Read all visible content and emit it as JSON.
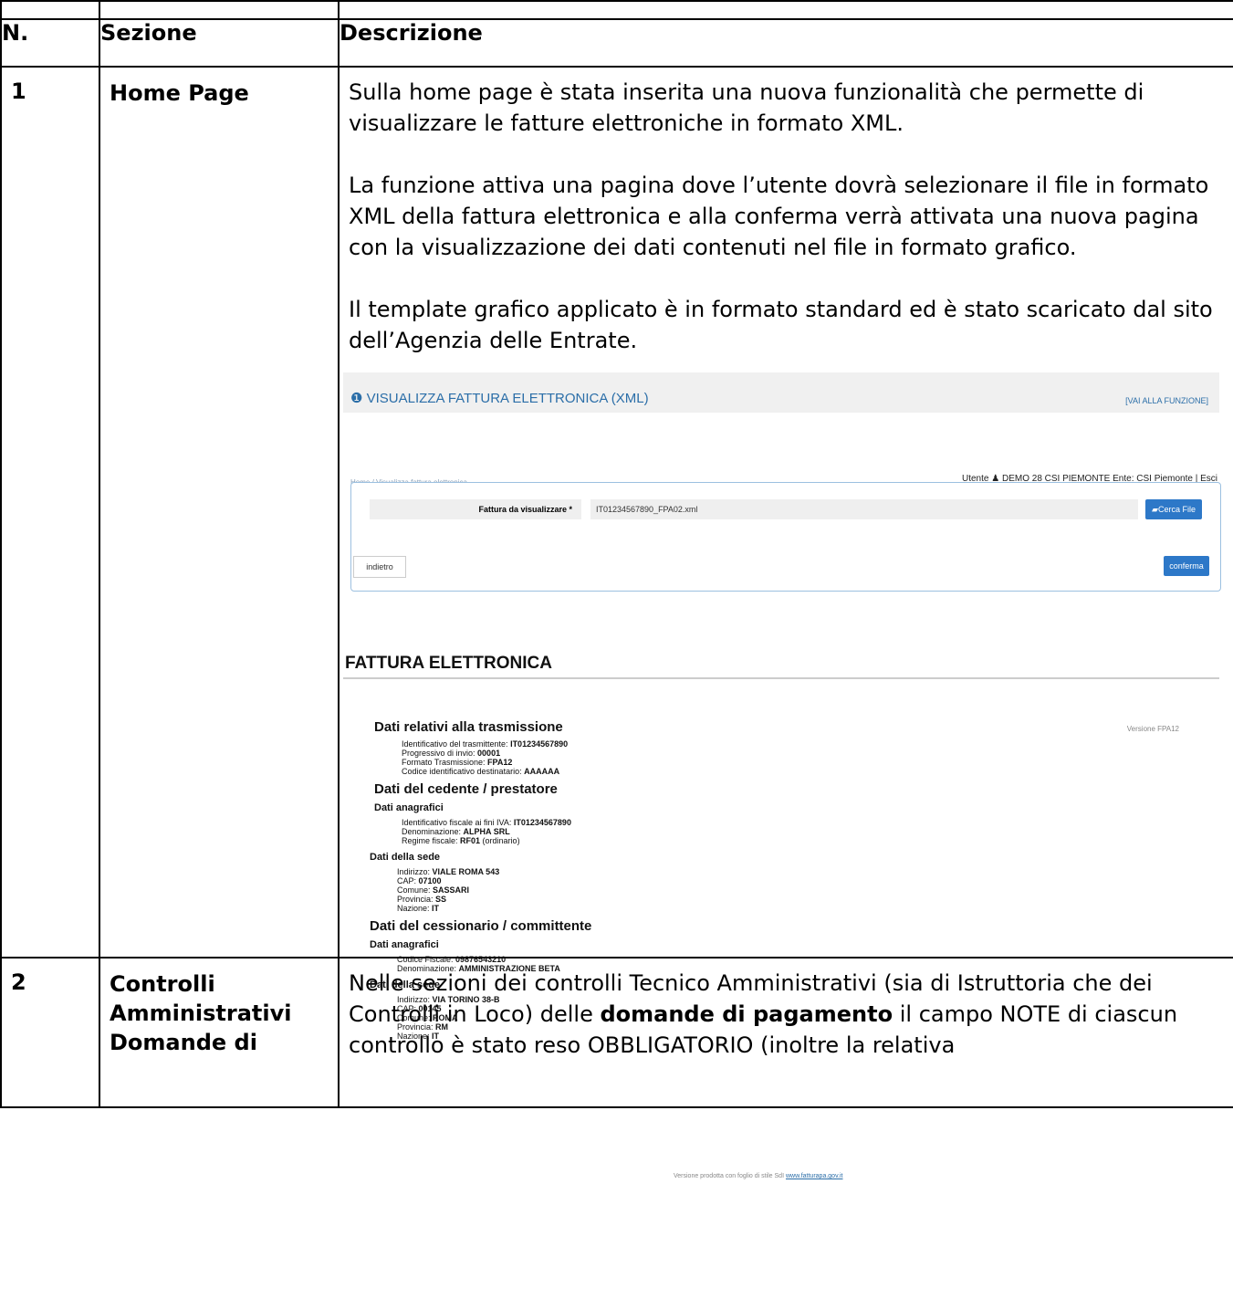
{
  "header": {
    "num": "N.",
    "sezione": "Sezione",
    "descrizione": "Descrizione"
  },
  "row1": {
    "num": "1",
    "sezione": "Home Page",
    "paragraphs": [
      "Sulla home page è stata inserita una nuova funzionalità che permette di visualizzare le fatture elettroniche in formato XML.",
      "La funzione attiva una pagina dove l’utente dovrà selezionare il file in formato XML della fattura elettronica e alla conferma verrà attivata una nuova pagina con la visualizzazione dei dati contenuti nel file in formato grafico.",
      "Il template grafico applicato è in formato standard ed è stato scaricato dal sito dell’Agenzia delle Entrate."
    ],
    "screenshot": {
      "title": "VISUALIZZA FATTURA ELETTRONICA (XML)",
      "link": "[VAI ALLA FUNZIONE]",
      "breadcrumb": "Home / Visualizza fattura elettronica",
      "user": "Utente ♟ DEMO 28 CSI PIEMONTE   Ente: CSI Piemonte | Esci",
      "field_label": "Fattura da visualizzare *",
      "field_value": "IT01234567890_FPA02.xml",
      "search_button": "Cerca File",
      "back_button": "indietro",
      "confirm_button": "conferma",
      "invoice_title": "FATTURA ELETTRONICA",
      "version": "Versione FPA12",
      "footer_text": "Versione prodotta con foglio di stile SdI",
      "footer_link": "www.fatturapa.gov.it",
      "trasmissione": {
        "title": "Dati relativi alla trasmissione",
        "l1": "Identificativo del trasmittente: ",
        "v1": "IT01234567890",
        "l2": "Progressivo di invio: ",
        "v2": "00001",
        "l3": "Formato Trasmissione: ",
        "v3": "FPA12",
        "l4": "Codice identificativo destinatario: ",
        "v4": "AAAAAA"
      },
      "cedente": {
        "title": "Dati del cedente / prestatore",
        "anagrafici": "Dati anagrafici",
        "l1": "Identificativo fiscale ai fini IVA: ",
        "v1": "IT01234567890",
        "l2": "Denominazione: ",
        "v2": "ALPHA SRL",
        "l3": "Regime fiscale: ",
        "v3": "RF01",
        "v3b": " (ordinario)",
        "sede": "Dati della sede",
        "s1": "Indirizzo: ",
        "sv1": "VIALE ROMA 543",
        "s2": "CAP: ",
        "sv2": "07100",
        "s3": "Comune: ",
        "sv3": "SASSARI",
        "s4": "Provincia: ",
        "sv4": "SS",
        "s5": "Nazione: ",
        "sv5": "IT"
      },
      "cessionario": {
        "title": "Dati del cessionario / committente",
        "anagrafici": "Dati anagrafici",
        "l1": "Codice Fiscale: ",
        "v1": "09876543210",
        "l2": "Denominazione: ",
        "v2": "AMMINISTRAZIONE BETA",
        "sede": "Dati della sede",
        "s1": "Indirizzo: ",
        "sv1": "VIA TORINO 38-B",
        "s2": "CAP: ",
        "sv2": "00145",
        "s3": "Comune: ",
        "sv3": "ROMA",
        "s4": "Provincia: ",
        "sv4": "RM",
        "s5": "Nazione: ",
        "sv5": "IT"
      }
    }
  },
  "row2": {
    "num": "2",
    "sezione": "Controlli Amministrativi Domande di",
    "text_a": "Nelle sezioni dei controlli Tecnico Amministrativi (sia di Istruttoria che dei Controlli in Loco) delle ",
    "text_bold": "domande di pagamento",
    "text_b": " il campo NOTE di ciascun controllo è stato reso OBBLIGATORIO (inoltre la relativa"
  }
}
